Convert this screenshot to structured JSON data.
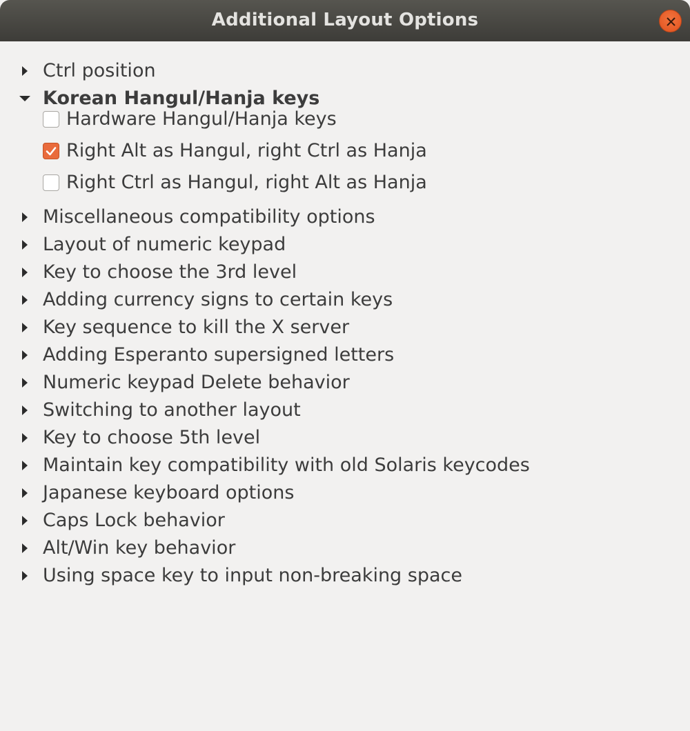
{
  "window": {
    "title": "Additional Layout Options"
  },
  "colors": {
    "accent": "#e96b3c",
    "titlebar": "#3d3c38",
    "background": "#f2f1f0"
  },
  "options": {
    "ctrl_position": "Ctrl position",
    "korean": {
      "label": "Korean Hangul/Hanja keys",
      "expanded": true,
      "children": [
        {
          "label": "Hardware Hangul/Hanja keys",
          "checked": false
        },
        {
          "label": "Right Alt as Hangul, right Ctrl as Hanja",
          "checked": true
        },
        {
          "label": "Right Ctrl as Hangul, right Alt as Hanja",
          "checked": false
        }
      ]
    },
    "rest": [
      "Miscellaneous compatibility options",
      "Layout of numeric keypad",
      "Key to choose the 3rd level",
      "Adding currency signs to certain keys",
      "Key sequence to kill the X server",
      "Adding Esperanto supersigned letters",
      "Numeric keypad Delete behavior",
      "Switching to another layout",
      "Key to choose 5th level",
      "Maintain key compatibility with old Solaris keycodes",
      "Japanese keyboard options",
      "Caps Lock behavior",
      "Alt/Win key behavior",
      "Using space key to input non-breaking space"
    ]
  }
}
